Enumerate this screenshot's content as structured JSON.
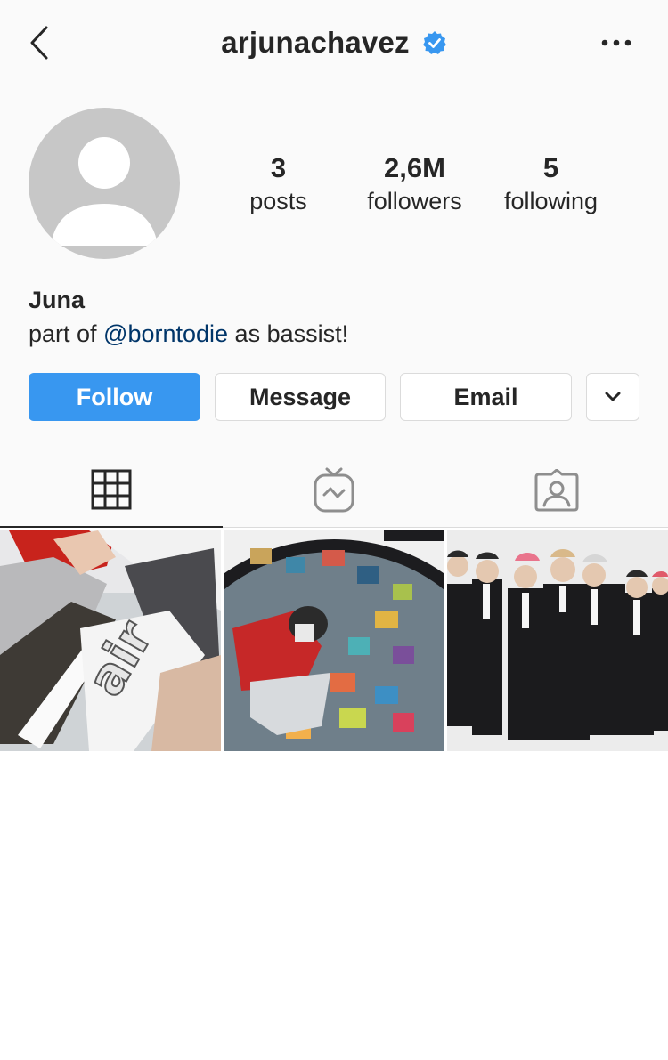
{
  "header": {
    "username": "arjunachavez",
    "back_icon": "chevron-left-icon",
    "verified_icon": "verified-badge-icon",
    "more_icon": "more-horizontal-icon"
  },
  "profile": {
    "avatar_icon": "default-avatar-icon",
    "stats": [
      {
        "value": "3",
        "label": "posts"
      },
      {
        "value": "2,6M",
        "label": "followers"
      },
      {
        "value": "5",
        "label": "following"
      }
    ],
    "name": "Juna",
    "bio": {
      "prefix": "part of ",
      "mention": "@borntodie",
      "suffix": " as bassist!"
    }
  },
  "actions": {
    "follow": "Follow",
    "message": "Message",
    "email": "Email",
    "more_icon": "chevron-down-icon"
  },
  "tabs": [
    {
      "icon": "grid-icon",
      "active": true
    },
    {
      "icon": "igtv-icon",
      "active": false
    },
    {
      "icon": "tagged-icon",
      "active": false
    }
  ],
  "posts": [
    {
      "description": "sneakers photo"
    },
    {
      "description": "fisheye room photo"
    },
    {
      "description": "group photo in suits"
    }
  ],
  "colors": {
    "accent": "#3897f0",
    "mention": "#003569",
    "verified": "#3897f0",
    "text": "#262626",
    "divider": "#dbdbdb"
  }
}
